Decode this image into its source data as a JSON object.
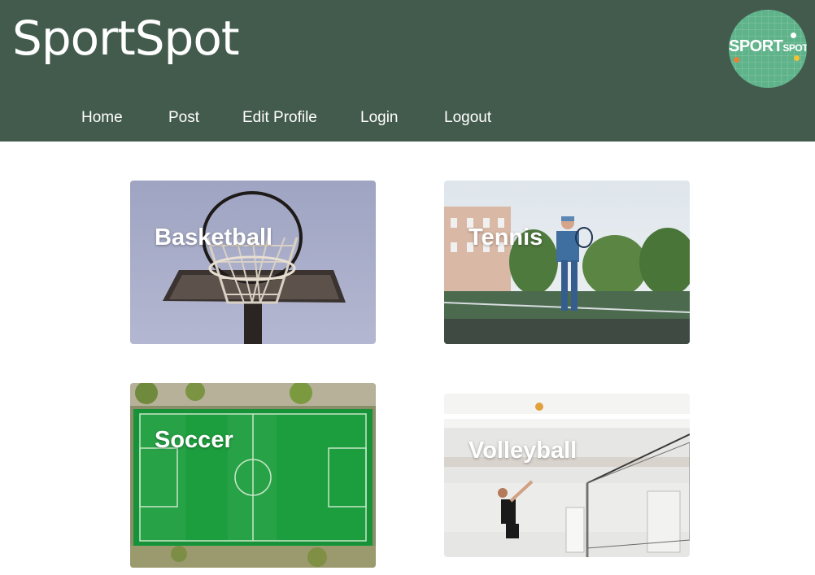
{
  "header": {
    "title": "SportSpot",
    "logo_text_main": "SPORT",
    "logo_text_sub": "SPOT"
  },
  "nav": {
    "items": [
      "Home",
      "Post",
      "Edit Profile",
      "Login",
      "Logout"
    ]
  },
  "sports": [
    {
      "name": "Basketball",
      "image": "basketball-hoop"
    },
    {
      "name": "Tennis",
      "image": "tennis-player-on-court"
    },
    {
      "name": "Soccer",
      "image": "aerial-soccer-field"
    },
    {
      "name": "Volleyball",
      "image": "volleyball-spike-indoor"
    }
  ],
  "colors": {
    "header_bg": "#435b4d",
    "logo_bg": "#5fb38a",
    "text": "#ffffff"
  }
}
